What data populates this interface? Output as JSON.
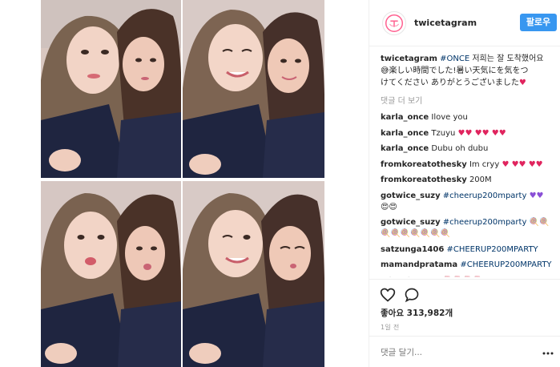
{
  "post": {
    "username": "twicetagram",
    "follow_label": "팔로우",
    "caption": {
      "user": "twicetagram",
      "tag": "#ONCE",
      "text_line1": " 저희는 잘 도착했어요",
      "text_line2": "楽しい時間でした!暑い天気にを気をつ",
      "text_line3": "けてください ありがとうございました"
    },
    "more_comments_label": "댓글 더 보기",
    "comments": [
      {
        "user": "karla_once",
        "text": "Ilove you"
      },
      {
        "user": "karla_once",
        "text": "Tzuyu"
      },
      {
        "user": "karla_once",
        "text": "Dubu oh dubu"
      },
      {
        "user": "fromkoreatothesky",
        "text": "Im cryy"
      },
      {
        "user": "fromkoreatothesky",
        "text": "200M"
      },
      {
        "user": "gotwice_suzy",
        "tag": "#cheerup200mparty"
      },
      {
        "user": "gotwice_suzy",
        "tag": "#cheerup200mparty"
      },
      {
        "user": "satzunga1406",
        "tag": "#CHEERUP200MPARTY"
      },
      {
        "user": "mamandpratama",
        "tag": "#CHEERUP200MPARTY"
      },
      {
        "user": "minacheonsa",
        "text": ""
      }
    ],
    "likes_label": "좋아요",
    "likes_count": "313,982개",
    "time": "1일 전",
    "add_comment_placeholder": "댓글 달기..."
  },
  "colors": {
    "follow_button": "#3897f0",
    "hashtag": "#003569",
    "muted": "#999999",
    "heart": "#e0245e"
  },
  "icons": [
    "heart-outline-icon",
    "comment-bubble-icon",
    "more-dots-icon",
    "red-heart-emoji",
    "lollipop-emoji",
    "purple-heart-emoji",
    "rose-emoji"
  ]
}
